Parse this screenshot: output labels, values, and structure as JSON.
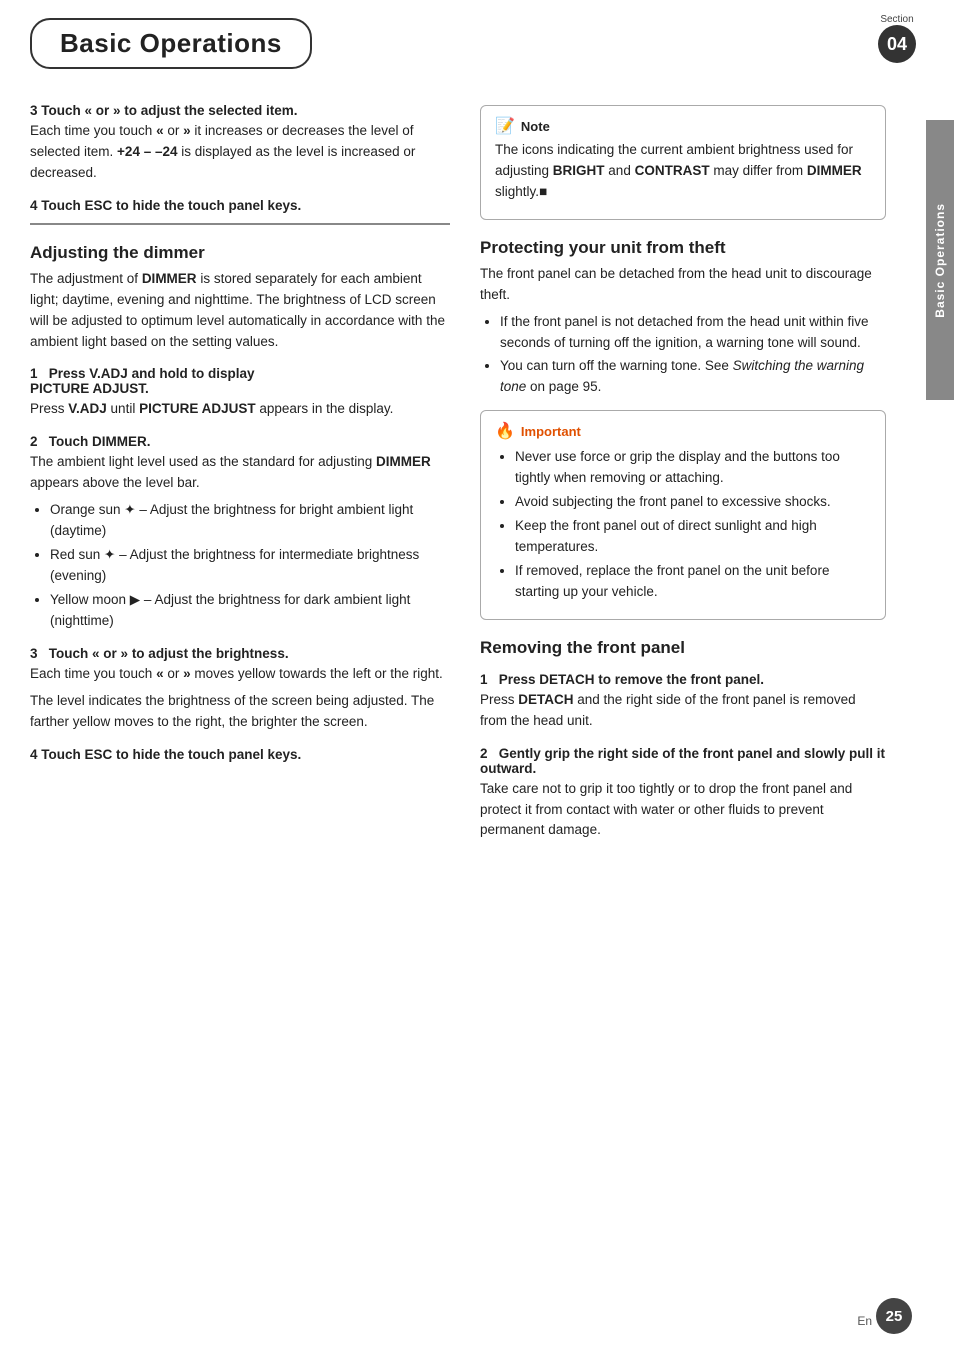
{
  "header": {
    "title": "Basic Operations",
    "section_label": "Section",
    "section_number": "04"
  },
  "side_tab": {
    "text": "Basic Operations"
  },
  "page_number": "25",
  "en_label": "En",
  "left_col": {
    "step3_heading": "3   Touch « or » to adjust the selected item.",
    "step3_body": "Each time you touch « or » it increases or decreases the level of selected item. +24 – –24 is displayed as the level is increased or decreased.",
    "step4_heading": "4   Touch ESC to hide the touch panel keys.",
    "adj_dimmer": {
      "heading": "Adjusting the dimmer",
      "body": "The adjustment of DIMMER is stored separately for each ambient light; daytime, evening and nighttime. The brightness of LCD screen will be adjusted to optimum level automatically in accordance with the ambient light based on the setting values.",
      "step1_heading": "1   Press V.ADJ and hold to display PICTURE ADJUST.",
      "step1_body": "Press V.ADJ until PICTURE ADJUST appears in the display.",
      "step2_heading": "2   Touch DIMMER.",
      "step2_body": "The ambient light level used as the standard for adjusting DIMMER appears above the level bar.",
      "bullets": [
        "Orange sun ☀ – Adjust the brightness for bright ambient light (daytime)",
        "Red sun ☀ – Adjust the brightness for intermediate brightness (evening)",
        "Yellow moon ☾ – Adjust the brightness for dark ambient light (nighttime)"
      ],
      "step3_heading": "3   Touch « or » to adjust the brightness.",
      "step3_body1": "Each time you touch « or » moves yellow towards the left or the right.",
      "step3_body2": "The level indicates the brightness of the screen being adjusted. The farther yellow moves to the right, the brighter the screen.",
      "step4_heading": "4   Touch ESC to hide the touch panel keys."
    }
  },
  "right_col": {
    "note": {
      "title": "Note",
      "body": "The icons indicating the current ambient brightness used for adjusting BRIGHT and CONTRAST may differ from DIMMER slightly."
    },
    "protect": {
      "heading": "Protecting your unit from theft",
      "body": "The front panel can be detached from the head unit to discourage theft.",
      "bullets": [
        "If the front panel is not detached from the head unit within five seconds of turning off the ignition, a warning tone will sound.",
        "You can turn off the warning tone. See Switching the warning tone on page 95."
      ]
    },
    "important": {
      "title": "Important",
      "bullets": [
        "Never use force or grip the display and the buttons too tightly when removing or attaching.",
        "Avoid subjecting the front panel to excessive shocks.",
        "Keep the front panel out of direct sunlight and high temperatures.",
        "If removed, replace the front panel on the unit before starting up your vehicle."
      ]
    },
    "removing": {
      "heading": "Removing the front panel",
      "step1_heading": "1   Press DETACH to remove the front panel.",
      "step1_body": "Press DETACH and the right side of the front panel is removed from the head unit.",
      "step2_heading": "2   Gently grip the right side of the front panel and slowly pull it outward.",
      "step2_body": "Take care not to grip it too tightly or to drop the front panel and protect it from contact with water or other fluids to prevent permanent damage."
    }
  }
}
